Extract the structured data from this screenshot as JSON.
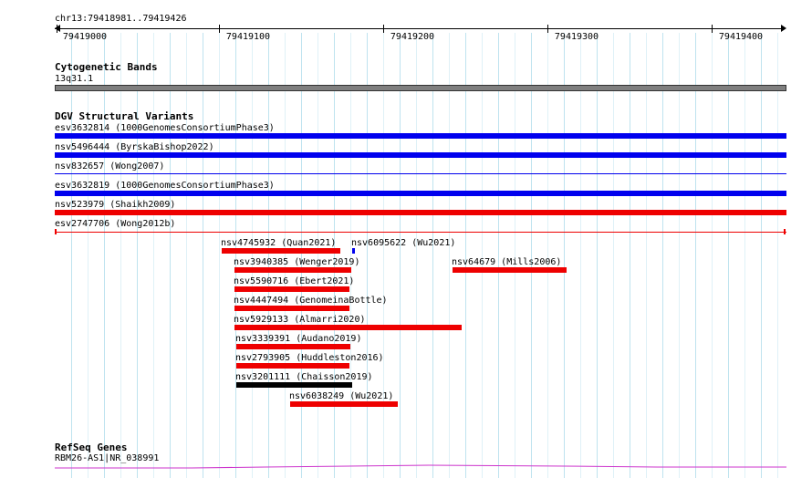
{
  "ruler": {
    "range_label": "chr13:79418981..79419426",
    "ticks": [
      {
        "label": "79419000",
        "pos": 79419000
      },
      {
        "label": "79419100",
        "pos": 79419100
      },
      {
        "label": "79419200",
        "pos": 79419200
      },
      {
        "label": "79419300",
        "pos": 79419300
      },
      {
        "label": "79419400",
        "pos": 79419400
      }
    ]
  },
  "cytoband_track": {
    "title": "Cytogenetic Bands",
    "band_label": "13q31.1",
    "band_color": "#7f7f7f"
  },
  "dgv_track": {
    "title": "DGV Structural Variants",
    "colors": {
      "gain": "#0000ee",
      "loss": "#ee0000",
      "complex": "#000000"
    },
    "variants": [
      {
        "label": "esv3632814 (1000GenomesConsortiumPhase3)",
        "color": "blue"
      },
      {
        "label": "nsv5496444 (ByrskaBishop2022)",
        "color": "blue"
      },
      {
        "label": "nsv832657 (Wong2007)",
        "color": "blue"
      },
      {
        "label": "esv3632819 (1000GenomesConsortiumPhase3)",
        "color": "blue"
      },
      {
        "label": "nsv523979 (Shaikh2009)",
        "color": "red"
      },
      {
        "label": "esv2747706 (Wong2012b)",
        "color": "red"
      },
      {
        "label": "nsv4745932 (Quan2021)",
        "color": "red"
      },
      {
        "label": "nsv6095622 (Wu2021)",
        "color": "blue"
      },
      {
        "label": "nsv3940385 (Wenger2019)",
        "color": "red"
      },
      {
        "label": "nsv64679 (Mills2006)",
        "color": "red"
      },
      {
        "label": "nsv5590716 (Ebert2021)",
        "color": "red"
      },
      {
        "label": "nsv4447494 (GenomeinaBottle)",
        "color": "red"
      },
      {
        "label": "nsv5929133 (Almarri2020)",
        "color": "red"
      },
      {
        "label": "nsv3339391 (Audano2019)",
        "color": "red"
      },
      {
        "label": "nsv2793905 (Huddleston2016)",
        "color": "red"
      },
      {
        "label": "nsv3201111 (Chaisson2019)",
        "color": "black"
      },
      {
        "label": "nsv6038249 (Wu2021)",
        "color": "red"
      }
    ]
  },
  "refseq_track": {
    "title": "RefSeq Genes",
    "gene_label": "RBM26-AS1|NR_038991",
    "gene_color": "#cc33cc"
  }
}
